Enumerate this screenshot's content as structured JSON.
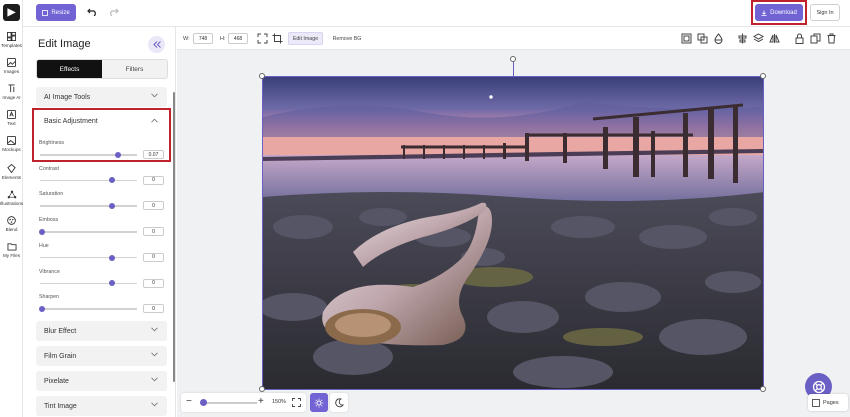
{
  "rail": {
    "items": [
      {
        "label": "Templates",
        "icon": "templates-icon"
      },
      {
        "label": "Images",
        "icon": "images-icon"
      },
      {
        "label": "Image AI",
        "icon": "image-ai-icon"
      },
      {
        "label": "Text",
        "icon": "text-icon"
      },
      {
        "label": "Mockups",
        "icon": "mockups-icon"
      },
      {
        "label": "Elements",
        "icon": "elements-icon"
      },
      {
        "label": "Illustrations",
        "icon": "illustrations-icon"
      },
      {
        "label": "Blend",
        "icon": "blend-icon"
      },
      {
        "label": "My Files",
        "icon": "folder-icon"
      }
    ]
  },
  "topbar": {
    "resize_label": "Resize",
    "download_label": "Download",
    "signin_label": "Sign In"
  },
  "panel": {
    "title": "Edit Image",
    "tabs": {
      "effects": "Effects",
      "filters": "Filters"
    },
    "ai_tools": "AI Image Tools",
    "basic_adjustment": "Basic Adjustment",
    "sliders": [
      {
        "label": "Brightness",
        "value": "0.07",
        "fraction": 0.8
      },
      {
        "label": "Contrast",
        "value": "0",
        "fraction": 0.74
      },
      {
        "label": "Saturation",
        "value": "0",
        "fraction": 0.74
      },
      {
        "label": "Emboss",
        "value": "0",
        "fraction": 0.02
      },
      {
        "label": "Hue",
        "value": "0",
        "fraction": 0.74
      },
      {
        "label": "Vibrance",
        "value": "0",
        "fraction": 0.74
      },
      {
        "label": "Sharpen",
        "value": "0",
        "fraction": 0.02
      }
    ],
    "sections": [
      "Blur Effect",
      "Film Grain",
      "Pixelate",
      "Tint Image"
    ]
  },
  "canvas_toolbar": {
    "w_label": "W:",
    "w_value": "748",
    "h_label": "H:",
    "h_value": "468",
    "edit_image": "Edit Image",
    "remove_bg": "Remove BG"
  },
  "bottom": {
    "zoom": "150%",
    "pages_label": "Pages"
  },
  "colors": {
    "accent": "#7163d4",
    "highlight": "#c0222b"
  }
}
